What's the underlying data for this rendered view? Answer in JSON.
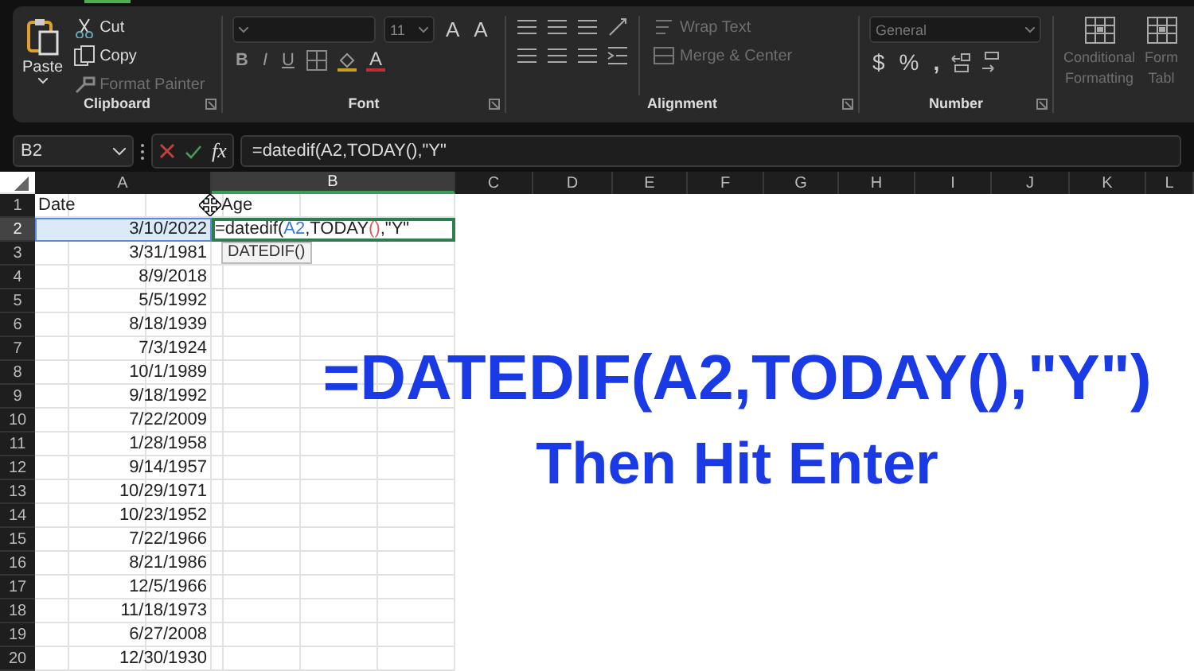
{
  "ribbon": {
    "groups": [
      {
        "kind": "clipboard",
        "label": "Clipboard",
        "paste": "Paste",
        "items": [
          {
            "label": "Cut",
            "disabled": false
          },
          {
            "label": "Copy",
            "disabled": false
          },
          {
            "label": "Format Painter",
            "disabled": true
          }
        ]
      },
      {
        "kind": "font",
        "label": "Font",
        "font_size": "11",
        "size_buttons": [
          "A",
          "A"
        ],
        "format_buttons": [
          "B",
          "I",
          "U"
        ],
        "color_button": "A"
      },
      {
        "kind": "alignment",
        "label": "Alignment",
        "items": [
          {
            "label": "Wrap Text",
            "disabled": true
          },
          {
            "label": "Merge & Center",
            "disabled": true
          }
        ]
      },
      {
        "kind": "number",
        "label": "Number",
        "format": "General",
        "symbols": [
          "$",
          "%",
          ","
        ]
      },
      {
        "kind": "styles",
        "items": [
          {
            "lines": [
              "Conditional",
              "Formatting"
            ],
            "disabled": true
          },
          {
            "lines": [
              "Form",
              "Tabl"
            ],
            "disabled": true
          }
        ]
      }
    ]
  },
  "formula_bar": {
    "name_box": "B2",
    "fx": "fx",
    "formula": "=datedif(A2,TODAY(),\"Y\""
  },
  "sheet": {
    "columns": [
      {
        "label": "A",
        "selected": false
      },
      {
        "label": "B",
        "selected": true
      },
      {
        "label": "C",
        "selected": false
      },
      {
        "label": "D",
        "selected": false
      },
      {
        "label": "E",
        "selected": false
      },
      {
        "label": "F",
        "selected": false
      },
      {
        "label": "G",
        "selected": false
      },
      {
        "label": "H",
        "selected": false
      },
      {
        "label": "I",
        "selected": false
      },
      {
        "label": "J",
        "selected": false
      },
      {
        "label": "K",
        "selected": false
      },
      {
        "label": "L",
        "selected": false
      }
    ],
    "rows": [
      {
        "number": "1",
        "a": "Date",
        "b": "Age",
        "kind": "header",
        "selected": false
      },
      {
        "number": "2",
        "a": "3/10/2022",
        "kind": "edit",
        "selected": true,
        "segments": [
          {
            "text": "=datedif(",
            "kind": "plain"
          },
          {
            "text": "A2",
            "kind": "ref"
          },
          {
            "text": ",TODAY",
            "kind": "plain"
          },
          {
            "text": "()",
            "kind": "paren"
          },
          {
            "text": ",\"Y\"",
            "kind": "plain"
          }
        ],
        "tooltip": "DATEDIF()"
      },
      {
        "number": "3",
        "a": "3/31/1981",
        "kind": "date",
        "selected": false
      },
      {
        "number": "4",
        "a": "8/9/2018",
        "kind": "date",
        "selected": false
      },
      {
        "number": "5",
        "a": "5/5/1992",
        "kind": "date",
        "selected": false
      },
      {
        "number": "6",
        "a": "8/18/1939",
        "kind": "date",
        "selected": false
      },
      {
        "number": "7",
        "a": "7/3/1924",
        "kind": "date",
        "selected": false
      },
      {
        "number": "8",
        "a": "10/1/1989",
        "kind": "date",
        "selected": false
      },
      {
        "number": "9",
        "a": "9/18/1992",
        "kind": "date",
        "selected": false
      },
      {
        "number": "10",
        "a": "7/22/2009",
        "kind": "date",
        "selected": false
      },
      {
        "number": "11",
        "a": "1/28/1958",
        "kind": "date",
        "selected": false
      },
      {
        "number": "12",
        "a": "9/14/1957",
        "kind": "date",
        "selected": false
      },
      {
        "number": "13",
        "a": "10/29/1971",
        "kind": "date",
        "selected": false
      },
      {
        "number": "14",
        "a": "10/23/1952",
        "kind": "date",
        "selected": false
      },
      {
        "number": "15",
        "a": "7/22/1966",
        "kind": "date",
        "selected": false
      },
      {
        "number": "16",
        "a": "8/21/1986",
        "kind": "date",
        "selected": false
      },
      {
        "number": "17",
        "a": "12/5/1966",
        "kind": "date",
        "selected": false
      },
      {
        "number": "18",
        "a": "11/18/1973",
        "kind": "date",
        "selected": false
      },
      {
        "number": "19",
        "a": "6/27/2008",
        "kind": "date",
        "selected": false
      },
      {
        "number": "20",
        "a": "12/30/1930",
        "kind": "date",
        "selected": false
      }
    ]
  },
  "overlay": {
    "headline": "=DATEDIF(A2,TODAY(),\"Y\")",
    "subline": "Then Hit Enter"
  }
}
